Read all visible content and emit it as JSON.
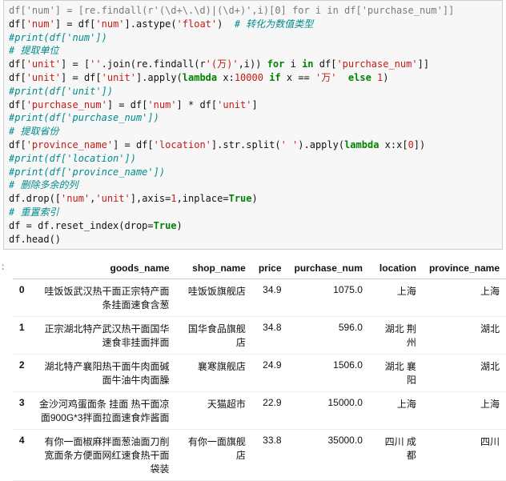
{
  "code": {
    "l0": "df['num'] = [re.findall(r'(\\d+\\.\\d)|(\\d+)',i)[0] for i in df['purchase_num']]",
    "l1a": "df[",
    "l1b": "'num'",
    "l1c": "] = df[",
    "l1d": "'num'",
    "l1e": "].astype(",
    "l1f": "'float'",
    "l1g": ")  ",
    "l1cmt": "# 转化为数值类型",
    "l2": "#print(df['num'])",
    "l3": "# 提取单位",
    "l4a": "df[",
    "l4b": "'unit'",
    "l4c": "] = [",
    "l4d": "''",
    "l4e": ".join(re.findall(r",
    "l4f": "'(万)'",
    "l4g": ",i)) ",
    "l4kw": "for",
    "l4h": " i ",
    "l4kw2": "in",
    "l4i": " df[",
    "l4j": "'purchase_num'",
    "l4k": "]]",
    "l5a": "df[",
    "l5b": "'unit'",
    "l5c": "] = df[",
    "l5d": "'unit'",
    "l5e": "].apply(",
    "l5kw": "lambda",
    "l5f": " x:",
    "l5n1": "10000",
    "l5g": " ",
    "l5kw2": "if",
    "l5h": " x == ",
    "l5i": "'万'",
    "l5j": "  ",
    "l5kw3": "else",
    "l5k": " ",
    "l5n2": "1",
    "l5l": ")",
    "l6": "#print(df['unit'])",
    "l7a": "df[",
    "l7b": "'purchase_num'",
    "l7c": "] = df[",
    "l7d": "'num'",
    "l7e": "] * df[",
    "l7f": "'unit'",
    "l7g": "]",
    "l8": "#print(df['purchase_num'])",
    "l9": "# 提取省份",
    "l10a": "df[",
    "l10b": "'province_name'",
    "l10c": "] = df[",
    "l10d": "'location'",
    "l10e": "].str.split(",
    "l10f": "' '",
    "l10g": ").apply(",
    "l10kw": "lambda",
    "l10h": " x:x[",
    "l10n": "0",
    "l10i": "])",
    "l11": "#print(df['location'])",
    "l12": "#print(df['province_name'])",
    "l13": "# 删除多余的列",
    "l14a": "df.drop([",
    "l14b": "'num'",
    "l14c": ",",
    "l14d": "'unit'",
    "l14e": "],axis=",
    "l14n": "1",
    "l14f": ",inplace=",
    "l14kw": "True",
    "l14g": ")",
    "l15": "# 重置索引",
    "l16a": "df = df.reset_index(drop=",
    "l16kw": "True",
    "l16b": ")",
    "l17": "df.head()"
  },
  "table": {
    "headers": {
      "h0": "",
      "h1": "goods_name",
      "h2": "shop_name",
      "h3": "price",
      "h4": "purchase_num",
      "h5": "location",
      "h6": "province_name"
    },
    "rows": [
      {
        "idx": "0",
        "goods": "哇饭饭武汉热干面正宗特产面条挂面速食含葱",
        "shop": "哇饭饭旗舰店",
        "price": "34.9",
        "pnum": "1075.0",
        "loc": "上海",
        "prov": "上海"
      },
      {
        "idx": "1",
        "goods": "正宗湖北特产武汉热干面国华速食非挂面拌面",
        "shop": "国华食品旗舰店",
        "price": "34.8",
        "pnum": "596.0",
        "loc": "湖北 荆州",
        "prov": "湖北"
      },
      {
        "idx": "2",
        "goods": "湖北特产襄阳热干面牛肉面碱面牛油牛肉面臊",
        "shop": "襄寒旗舰店",
        "price": "24.9",
        "pnum": "1506.0",
        "loc": "湖北 襄阳",
        "prov": "湖北"
      },
      {
        "idx": "3",
        "goods": "金沙河鸡蛋面条 挂面 热干面凉面900G*3拌面拉面速食炸酱面",
        "shop": "天猫超市",
        "price": "22.9",
        "pnum": "15000.0",
        "loc": "上海",
        "prov": "上海"
      },
      {
        "idx": "4",
        "goods": "有你一面椒麻拌面葱油面刀削宽面条方便面网红速食热干面袋装",
        "shop": "有你一面旗舰店",
        "price": "33.8",
        "pnum": "35000.0",
        "loc": "四川 成都",
        "prov": "四川"
      }
    ]
  },
  "gutter": ":"
}
